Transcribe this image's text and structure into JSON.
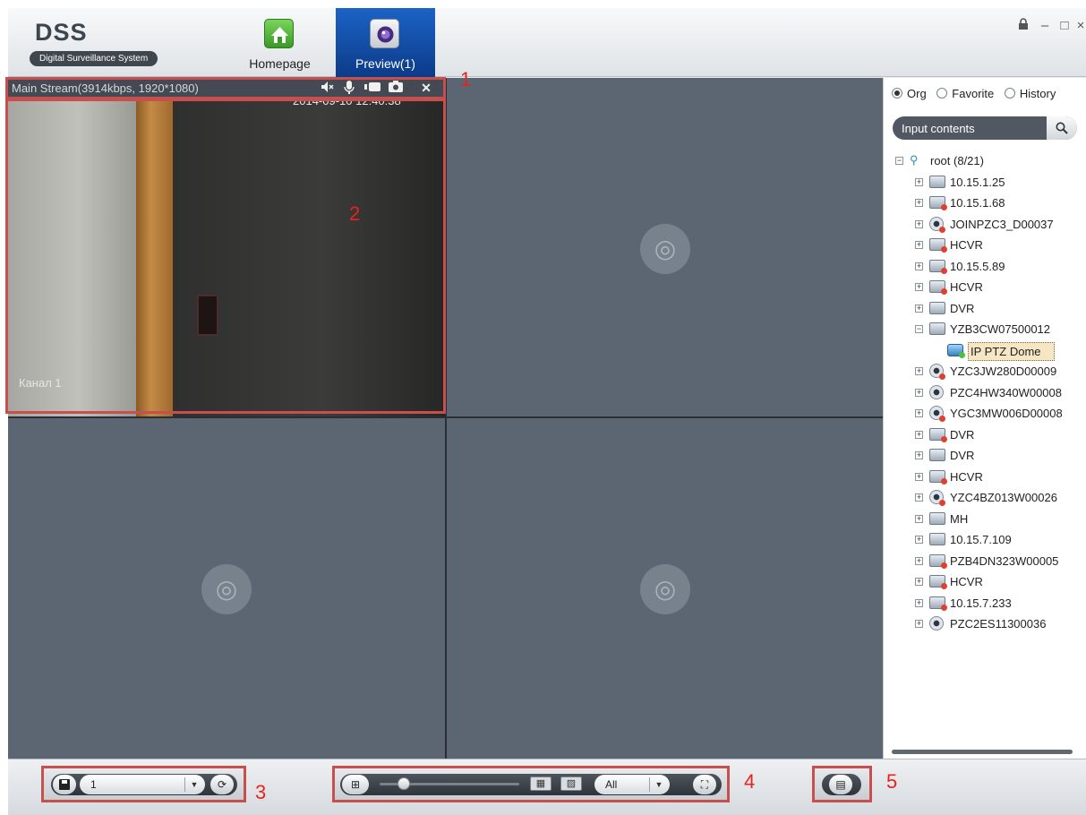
{
  "app": {
    "title": "DSS",
    "subtitle": "Digital Surveillance System"
  },
  "nav": [
    {
      "label": "Homepage",
      "icon": "home-icon",
      "active": false
    },
    {
      "label": "Preview(1)",
      "icon": "camera-icon",
      "active": true
    }
  ],
  "window_controls": {
    "lock": "🔒",
    "minimize": "–",
    "maximize": "□",
    "close": "×"
  },
  "video": {
    "active_cell": {
      "stream_info": "Main Stream(3914kbps, 1920*1080)",
      "osd_time": "2014-09-10 12:40:38",
      "osd_channel": "Канал 1",
      "tools": [
        "audio-off-icon",
        "microphone-icon",
        "record-icon",
        "snapshot-icon",
        "close-icon"
      ],
      "tool_glyphs": [
        "◀︎",
        "🎙",
        "⏺",
        "◙",
        "✕"
      ]
    },
    "placeholder_glyph": "◎"
  },
  "panel": {
    "radios": [
      {
        "label": "Org",
        "selected": true
      },
      {
        "label": "Favorite",
        "selected": false
      },
      {
        "label": "History",
        "selected": false
      }
    ],
    "search": {
      "placeholder": "Input contents",
      "icon": "search-icon",
      "glyph": "🔍"
    },
    "tree": [
      {
        "label": "root (8/21)",
        "level": 0,
        "expanded": true,
        "icon": "root",
        "status": "online"
      },
      {
        "label": "10.15.1.25",
        "level": 1,
        "expanded": false,
        "icon": "device",
        "status": "online"
      },
      {
        "label": "10.15.1.68",
        "level": 1,
        "expanded": false,
        "icon": "device",
        "status": "offline"
      },
      {
        "label": "JOINPZC3_D00037",
        "level": 1,
        "expanded": false,
        "icon": "camera",
        "status": "offline"
      },
      {
        "label": "HCVR",
        "level": 1,
        "expanded": false,
        "icon": "device",
        "status": "offline"
      },
      {
        "label": "10.15.5.89",
        "level": 1,
        "expanded": false,
        "icon": "device",
        "status": "offline"
      },
      {
        "label": "HCVR",
        "level": 1,
        "expanded": false,
        "icon": "device",
        "status": "offline"
      },
      {
        "label": "DVR",
        "level": 1,
        "expanded": false,
        "icon": "device",
        "status": "online"
      },
      {
        "label": "YZB3CW07500012",
        "level": 1,
        "expanded": true,
        "icon": "device",
        "status": "online"
      },
      {
        "label": "IP PTZ Dome",
        "level": 2,
        "expanded": null,
        "icon": "ptz",
        "status": "online",
        "selected": true
      },
      {
        "label": "YZC3JW280D00009",
        "level": 1,
        "expanded": false,
        "icon": "camera",
        "status": "offline"
      },
      {
        "label": "PZC4HW340W00008",
        "level": 1,
        "expanded": false,
        "icon": "camera",
        "status": "online"
      },
      {
        "label": "YGC3MW006D00008",
        "level": 1,
        "expanded": false,
        "icon": "camera",
        "status": "offline"
      },
      {
        "label": "DVR",
        "level": 1,
        "expanded": false,
        "icon": "device",
        "status": "offline"
      },
      {
        "label": "DVR",
        "level": 1,
        "expanded": false,
        "icon": "device",
        "status": "online"
      },
      {
        "label": "HCVR",
        "level": 1,
        "expanded": false,
        "icon": "device",
        "status": "offline"
      },
      {
        "label": "YZC4BZ013W00026",
        "level": 1,
        "expanded": false,
        "icon": "camera",
        "status": "offline"
      },
      {
        "label": "MH",
        "level": 1,
        "expanded": false,
        "icon": "device",
        "status": "online"
      },
      {
        "label": "10.15.7.109",
        "level": 1,
        "expanded": false,
        "icon": "device",
        "status": "online"
      },
      {
        "label": "PZB4DN323W00005",
        "level": 1,
        "expanded": false,
        "icon": "device",
        "status": "offline"
      },
      {
        "label": "HCVR",
        "level": 1,
        "expanded": false,
        "icon": "device",
        "status": "offline"
      },
      {
        "label": "10.15.7.233",
        "level": 1,
        "expanded": false,
        "icon": "device",
        "status": "offline"
      },
      {
        "label": "PZC2ES11300036",
        "level": 1,
        "expanded": false,
        "icon": "camera",
        "status": "online"
      }
    ]
  },
  "bottom": {
    "save_view": {
      "icon": "save-icon",
      "glyph": "▣"
    },
    "view_select": {
      "value": "1",
      "arrow": "▼"
    },
    "refresh": {
      "icon": "refresh-icon",
      "glyph": "⟳"
    },
    "layout_single": {
      "icon": "single-layout-icon",
      "glyph": "⊞"
    },
    "layout_grid": {
      "icon": "grid-layout-icon",
      "glyph": "▦"
    },
    "layout_custom": {
      "icon": "custom-layout-icon",
      "glyph": "▨"
    },
    "stream_filter": {
      "value": "All",
      "arrow": "▼"
    },
    "fullscreen": {
      "icon": "fullscreen-icon",
      "glyph": "⛶"
    },
    "tv_wall": {
      "icon": "tv-wall-icon",
      "glyph": "▤"
    }
  },
  "annotations": [
    "1",
    "2",
    "3",
    "4",
    "5"
  ],
  "colors": {
    "annotation": "#c7504f",
    "annotation_text": "#e8231f",
    "active_tab": "#1b63c6",
    "cell_bg": "#5c6572"
  }
}
